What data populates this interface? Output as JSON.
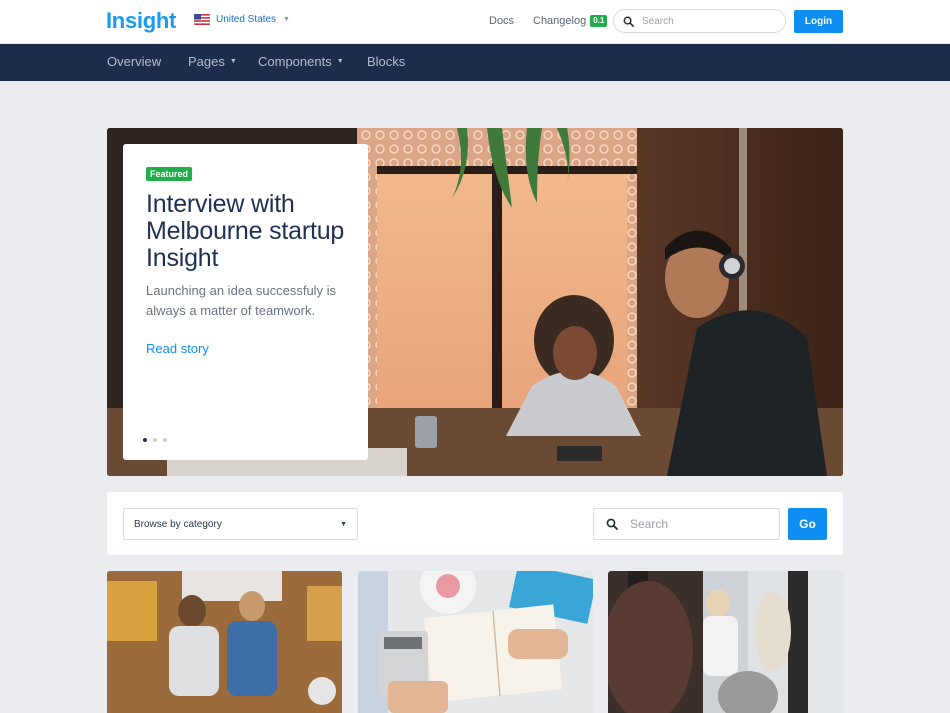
{
  "header": {
    "logo": "Insight",
    "locale": "United States",
    "docs": "Docs",
    "changelog": "Changelog",
    "changelog_badge": "0.1",
    "search_placeholder": "Search",
    "login": "Login"
  },
  "nav": {
    "items": [
      {
        "label": "Overview",
        "dropdown": false
      },
      {
        "label": "Pages",
        "dropdown": true
      },
      {
        "label": "Components",
        "dropdown": true
      },
      {
        "label": "Blocks",
        "dropdown": false
      }
    ]
  },
  "hero": {
    "badge": "Featured",
    "title": "Interview with Melbourne startup Insight",
    "description": "Launching an idea successfuly is always a matter of teamwork.",
    "cta": "Read story",
    "slides": 3,
    "active_slide": 1
  },
  "filter": {
    "category_value": "Browse by category",
    "search_placeholder": "Search",
    "go": "Go"
  },
  "colors": {
    "brand": "#1a9bf0",
    "primary": "#0f8ef3",
    "navbar": "#1c2c4c",
    "success": "#1fae4a",
    "background": "#eaecf0"
  },
  "icons": {
    "search": "search-icon",
    "flag": "us-flag-icon",
    "caret": "chevron-down-icon"
  }
}
